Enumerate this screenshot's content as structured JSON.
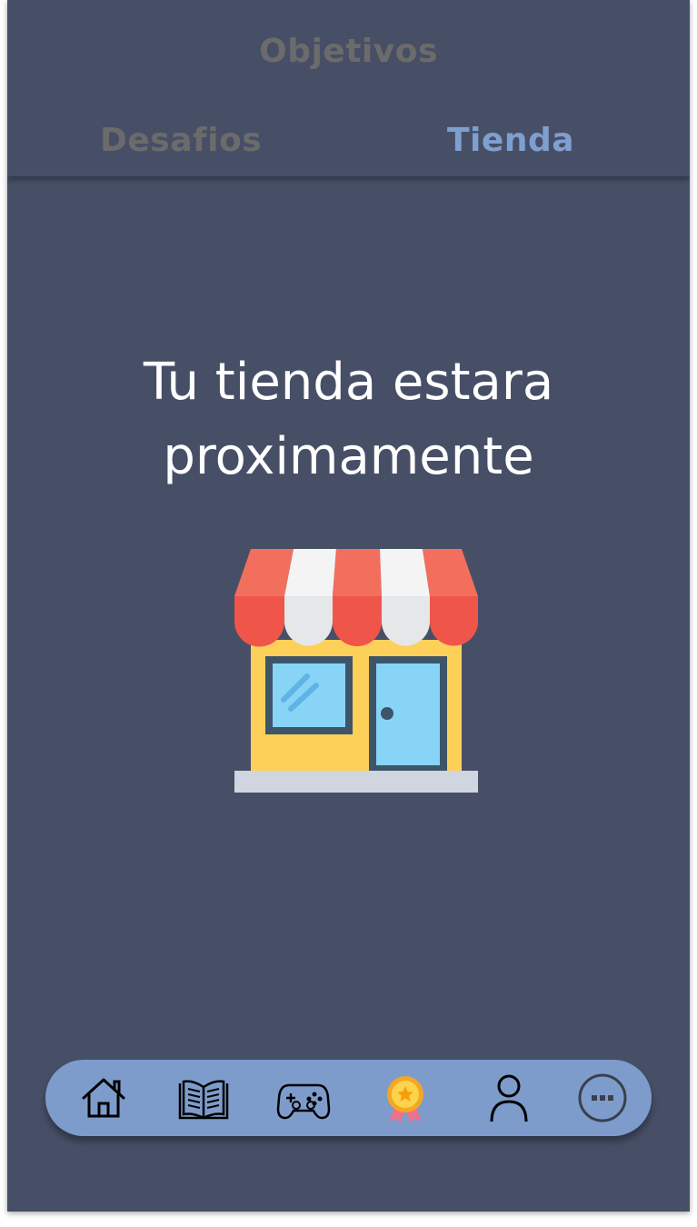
{
  "header": {
    "title": "Objetivos",
    "tabs": [
      {
        "label": "Desafios",
        "active": false
      },
      {
        "label": "Tienda",
        "active": true
      }
    ]
  },
  "main": {
    "message_line1": "Tu tienda estara",
    "message_line2": "proximamente",
    "illustration": "store-icon"
  },
  "nav": {
    "items": [
      {
        "icon": "home-icon"
      },
      {
        "icon": "book-icon"
      },
      {
        "icon": "gamepad-icon"
      },
      {
        "icon": "medal-icon",
        "active": true
      },
      {
        "icon": "user-icon"
      },
      {
        "icon": "more-icon"
      }
    ]
  },
  "colors": {
    "background": "#474f67",
    "tab_active": "#7f9fcf",
    "tab_inactive": "#6b6b6b",
    "navbar": "#7d9ccc"
  }
}
